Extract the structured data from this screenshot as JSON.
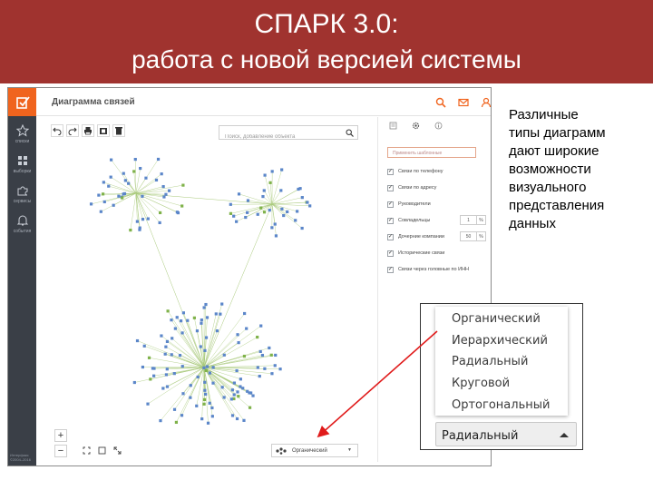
{
  "slide": {
    "title_line1": "СПАРК 3.0:",
    "title_line2": "работа с новой версией системы",
    "header_color": "#a0332f"
  },
  "app": {
    "title": "Диаграмма связей",
    "search_placeholder": "Поиск, добавление объекта",
    "rail": {
      "items": [
        {
          "label": "списки",
          "icon": "star-icon"
        },
        {
          "label": "выборки",
          "icon": "grid-icon"
        },
        {
          "label": "сервисы",
          "icon": "puzzle-icon"
        },
        {
          "label": "события",
          "icon": "bell-icon"
        }
      ],
      "footer": "Интерфакс ©2004–2016"
    },
    "top_icons": [
      "search-icon",
      "mail-icon",
      "user-icon"
    ],
    "toolbar_icons": [
      "undo-icon",
      "redo-icon",
      "print-icon",
      "export-icon",
      "delete-icon"
    ],
    "panel": {
      "tabs": [
        "list-icon",
        "settings-icon",
        "info-icon"
      ],
      "preset": "Применить шаблонные",
      "options": [
        {
          "label": "Связи по телефону",
          "checked": true
        },
        {
          "label": "Связи по адресу",
          "checked": true
        },
        {
          "label": "Руководители",
          "checked": true
        },
        {
          "label": "Совладельцы",
          "checked": true,
          "value": "1"
        },
        {
          "label": "Дочерние компании",
          "checked": true,
          "value": "50"
        },
        {
          "label": "Исторические связи",
          "checked": true
        },
        {
          "label": "Связи через головные по ИНН",
          "checked": true
        }
      ],
      "percent_unit": "%"
    },
    "zoom": {
      "in": "+",
      "out": "−"
    },
    "layout_select_value": "Органический",
    "accent": "#f0641e",
    "node_color": "#5b86c9",
    "edge_color": "#a8c97a"
  },
  "description": [
    "Различные",
    "типы диаграмм",
    "дают широкие",
    "возможности",
    "визуального",
    "представления",
    "данных"
  ],
  "dropdown": {
    "options": [
      "Органический",
      "Иерархический",
      "Радиальный",
      "Круговой",
      "Ортогональный"
    ],
    "selected": "Радиальный"
  },
  "arrow_color": "#e01b1b"
}
